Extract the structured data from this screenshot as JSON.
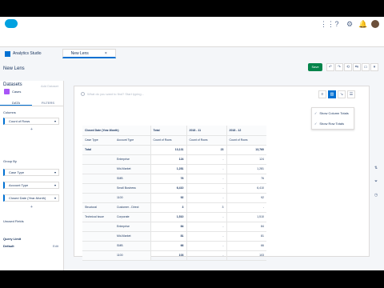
{
  "header": {
    "app_name": "Analytics Studio",
    "tab_label": "New Lens",
    "title": "New Lens",
    "save_label": "Save"
  },
  "sidebar": {
    "title": "Datasets",
    "edit_label": "Add Dataset",
    "dataset_name": "Cases",
    "tabs": [
      "DATA",
      "FILTERS"
    ],
    "measures_label": "Columns",
    "measure": "Count of Rows",
    "group_by_label": "Group By",
    "groups": [
      "Case Type",
      "Account Type",
      "Closed Date (Year-Month)"
    ],
    "unused_fields_label": "Unused Fields",
    "query_limit_label": "Query Limit",
    "query_limit_value": "Default",
    "query_limit_edit": "Edit"
  },
  "query": {
    "placeholder": "What do you want to find? Start typing..."
  },
  "menu": {
    "items": [
      "Show Column Totals",
      "Show Row Totals"
    ]
  },
  "table": {
    "group_header": [
      "Closed Date (Year-Month)",
      "Total",
      "2018 - 11",
      "2018 - 12"
    ],
    "col_header": [
      "Case Type",
      "Account Type",
      "Count of Rows",
      "Count of Rows",
      "Count of Rows"
    ],
    "rows": [
      [
        "Total",
        "",
        "13,131",
        "23",
        "13,760"
      ],
      [
        "",
        "Enterprise",
        "124",
        "-",
        "124"
      ],
      [
        "",
        "Mid-Market",
        "1,281",
        "-",
        "1,281"
      ],
      [
        "",
        "SMB",
        "76",
        "-",
        "76"
      ],
      [
        "",
        "Small Business",
        "6,410",
        "-",
        "6,410"
      ],
      [
        "",
        "1100",
        "92",
        "-",
        "92"
      ],
      [
        "Structural",
        "Customer - Direct",
        "3",
        "3",
        "-"
      ],
      [
        "Technical Issue",
        "Corporate",
        "1,510",
        "-",
        "1,510"
      ],
      [
        "",
        "Enterprise",
        "84",
        "-",
        "84"
      ],
      [
        "",
        "Mid-Market",
        "81",
        "-",
        "81"
      ],
      [
        "",
        "SMB",
        "66",
        "-",
        "66"
      ],
      [
        "",
        "1100",
        "103",
        "-",
        "103"
      ]
    ]
  }
}
